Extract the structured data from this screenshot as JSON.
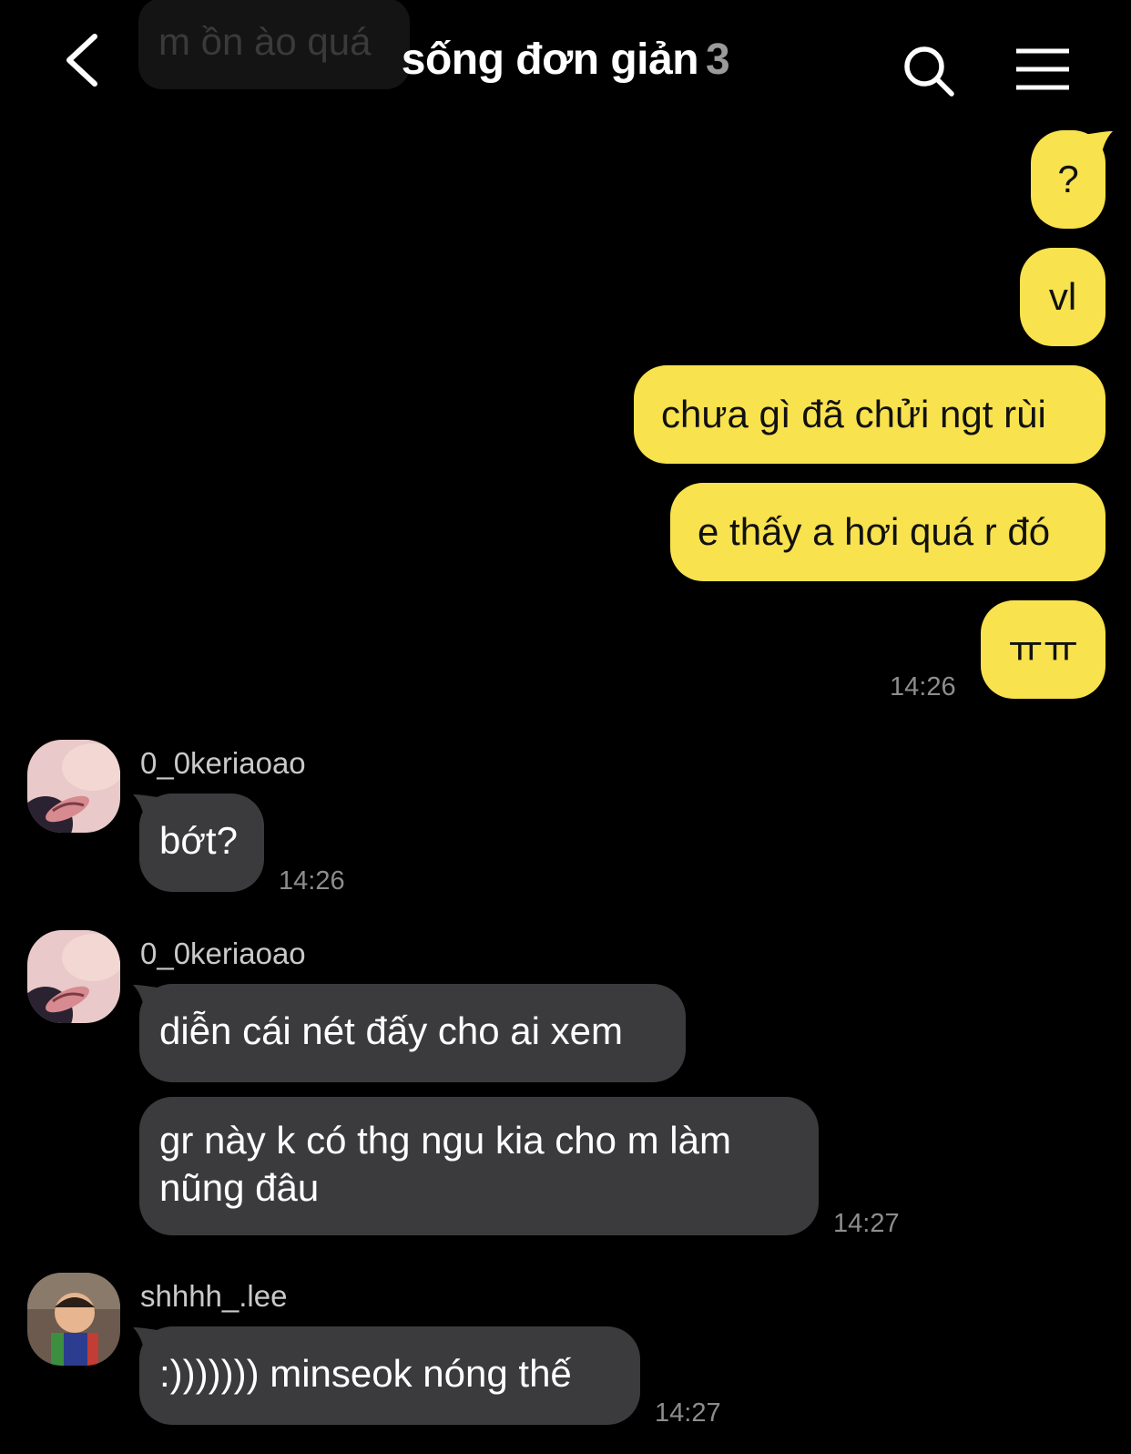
{
  "header": {
    "title": "sống đơn giản",
    "member_count": "3",
    "back_icon": "chevron-left-icon",
    "search_icon": "search-icon",
    "menu_icon": "hamburger-menu-icon"
  },
  "ghost_message": {
    "text": "m ồn ào quá"
  },
  "colors": {
    "background": "#000000",
    "my_bubble": "#f8e24d",
    "their_bubble": "#3b3b3d",
    "timestamp": "#8d8d8d",
    "username": "#c9c9c9"
  },
  "my_messages": [
    {
      "text": "?"
    },
    {
      "text": "vl"
    },
    {
      "text": "chưa gì đã chửi ngt rùi"
    },
    {
      "text": "e thấy a hơi quá r đó"
    },
    {
      "text": "ㅠㅠ"
    }
  ],
  "my_messages_time": "14:26",
  "groups": [
    {
      "username": "0_0keriaoao",
      "messages": [
        {
          "text": "bớt?"
        }
      ],
      "time": "14:26"
    },
    {
      "username": "0_0keriaoao",
      "messages": [
        {
          "text": "diễn cái nét đấy cho ai xem"
        },
        {
          "line1": "gr này k có thg ngu kia cho m làm",
          "line2": "nũng đâu"
        }
      ],
      "time": "14:27"
    },
    {
      "username": "shhhh_.lee",
      "messages": [
        {
          "text": ":))))))) minseok nóng thế"
        }
      ],
      "time": "14:27"
    }
  ]
}
